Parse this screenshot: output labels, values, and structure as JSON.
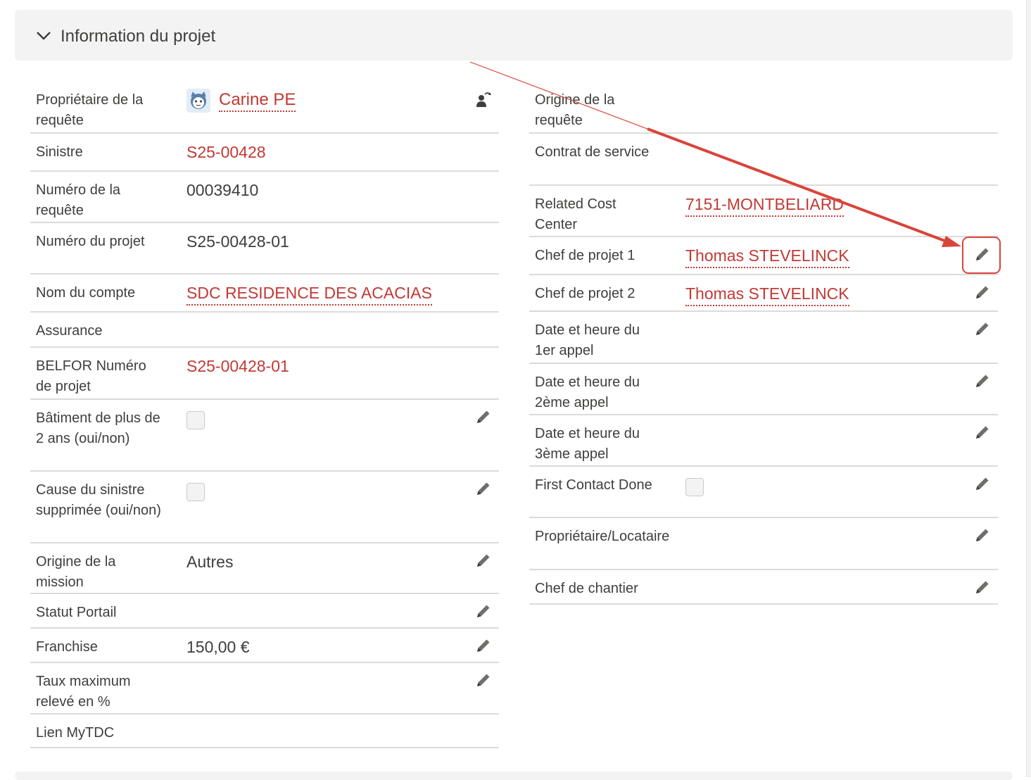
{
  "section": {
    "title": "Information du projet"
  },
  "left_fields": {
    "owner": {
      "label": "Propriétaire de la requête",
      "value": "Carine PE"
    },
    "sinistre": {
      "label": "Sinistre",
      "value": "S25-00428"
    },
    "numero_requete": {
      "label": "Numéro de la requête",
      "value": "00039410"
    },
    "numero_projet": {
      "label": "Numéro du projet",
      "value": "S25-00428-01"
    },
    "nom_compte": {
      "label": "Nom du compte",
      "value": "SDC RESIDENCE DES ACACIAS"
    },
    "assurance": {
      "label": "Assurance",
      "value": ""
    },
    "belfor": {
      "label": "BELFOR Numéro de projet",
      "value": "S25-00428-01"
    },
    "batiment": {
      "label": "Bâtiment de plus de 2 ans (oui/non)",
      "checked": false
    },
    "cause": {
      "label": "Cause du sinistre supprimée (oui/non)",
      "checked": false
    },
    "origine_mission": {
      "label": "Origine de la mission",
      "value": "Autres"
    },
    "statut_portail": {
      "label": "Statut Portail",
      "value": ""
    },
    "franchise": {
      "label": "Franchise",
      "value": "150,00 €"
    },
    "taux": {
      "label": "Taux maximum relevé en %",
      "value": ""
    },
    "lien": {
      "label": "Lien MyTDC",
      "value": ""
    }
  },
  "right_fields": {
    "origine_requete": {
      "label": "Origine de la requête",
      "value": ""
    },
    "contrat": {
      "label": "Contrat de service",
      "value": ""
    },
    "cost_center": {
      "label": "Related Cost Center",
      "value": "7151-MONTBELIARD"
    },
    "chef1": {
      "label": "Chef de projet 1",
      "value": "Thomas STEVELINCK"
    },
    "chef2": {
      "label": "Chef de projet 2",
      "value": "Thomas STEVELINCK"
    },
    "appel1": {
      "label": "Date et heure du 1er appel",
      "value": ""
    },
    "appel2": {
      "label": "Date et heure du 2ème appel",
      "value": ""
    },
    "appel3": {
      "label": "Date et heure du 3ème appel",
      "value": ""
    },
    "first_contact": {
      "label": "First Contact Done",
      "checked": false
    },
    "proprietaire": {
      "label": "Propriétaire/Locataire",
      "value": ""
    },
    "chantier": {
      "label": "Chef de chantier",
      "value": ""
    }
  },
  "icons": {
    "section_toggle": "chevron-down-icon",
    "edit": "pencil-icon",
    "change_owner": "change-owner-icon",
    "avatar": "user-avatar-icon"
  },
  "colors": {
    "link": "#c23934",
    "annotation": "#d9443a",
    "header_bg": "#f3f3f3",
    "divider": "#dddbda"
  }
}
